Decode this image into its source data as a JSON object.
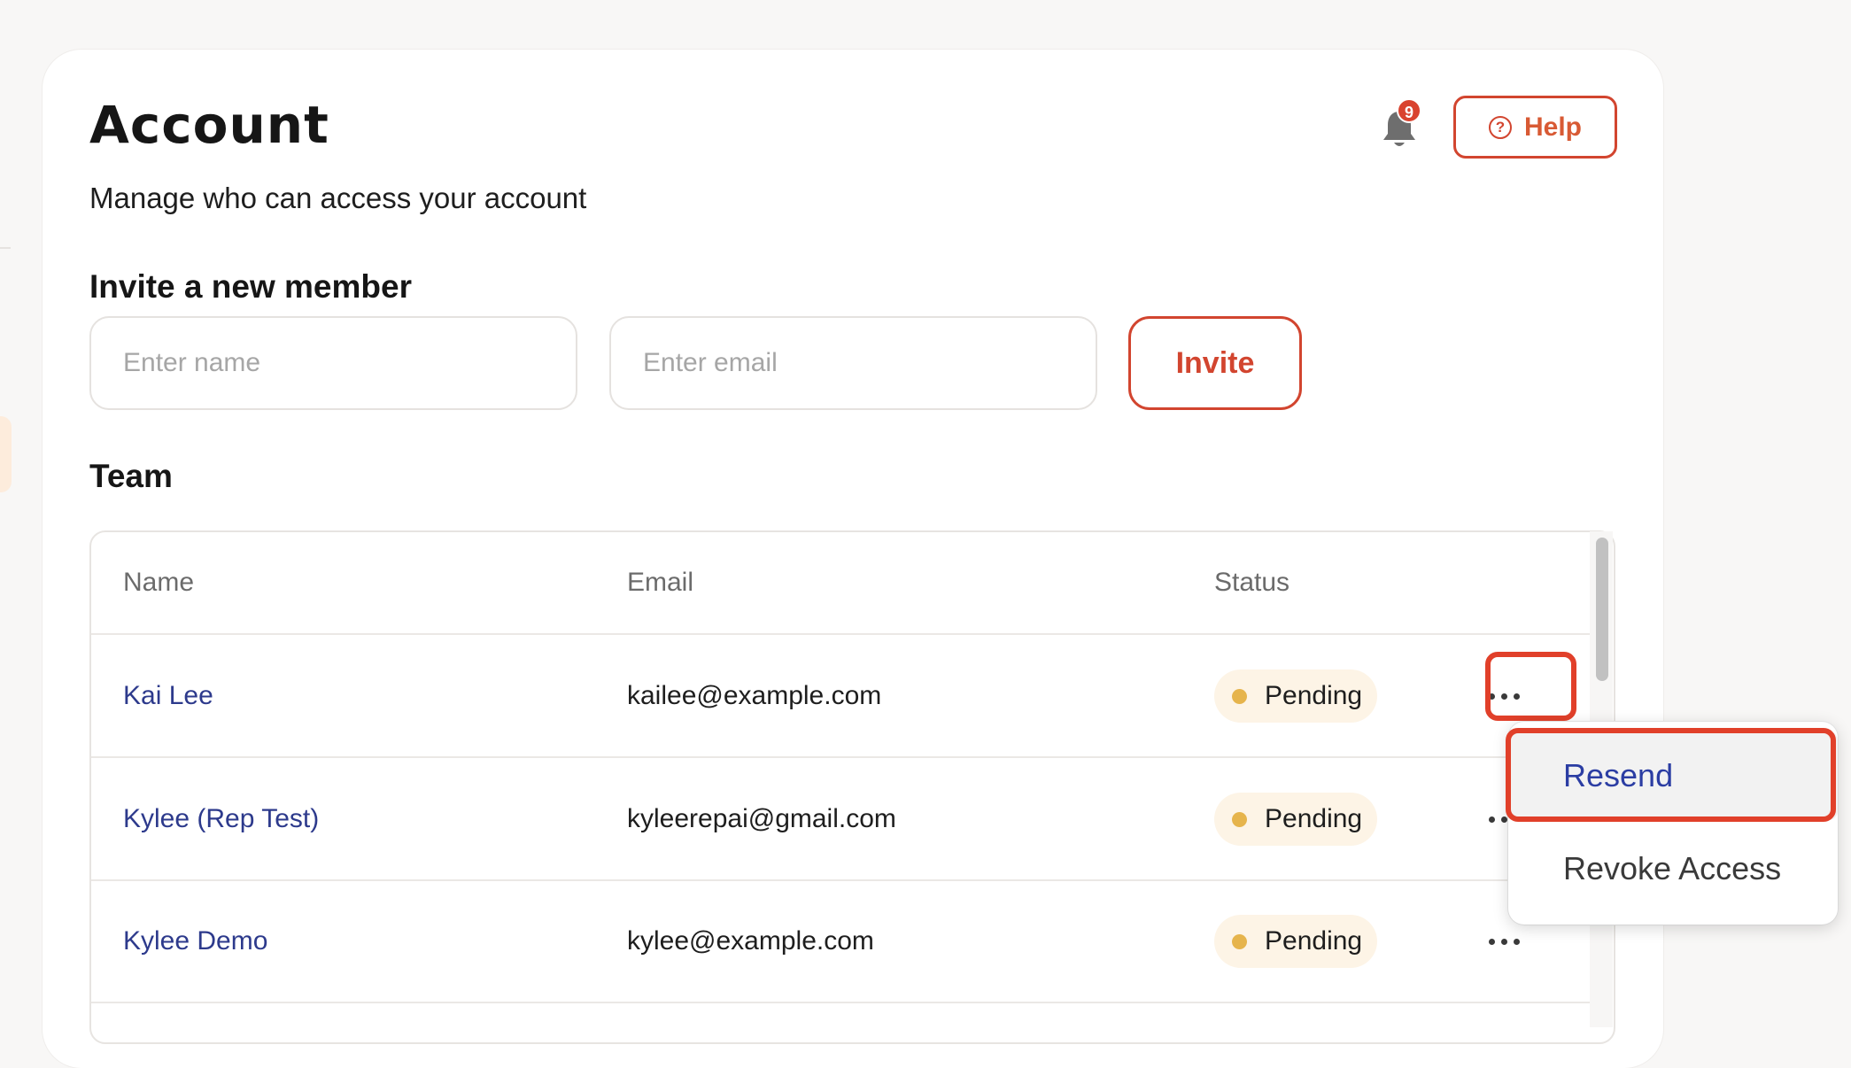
{
  "page": {
    "title": "Account",
    "subtitle": "Manage who can access your account"
  },
  "header": {
    "notification_count": "9",
    "help_label": "Help",
    "help_icon": "?"
  },
  "invite": {
    "section_title": "Invite a new member",
    "name_placeholder": "Enter name",
    "email_placeholder": "Enter email",
    "button_label": "Invite"
  },
  "team": {
    "section_title": "Team",
    "columns": [
      "Name",
      "Email",
      "Status"
    ],
    "rows": [
      {
        "name": "Kai Lee",
        "email": "kailee@example.com",
        "status": "Pending"
      },
      {
        "name": "Kylee (Rep Test)",
        "email": "kyleerepai@gmail.com",
        "status": "Pending"
      },
      {
        "name": "Kylee Demo",
        "email": "kylee@example.com",
        "status": "Pending"
      }
    ]
  },
  "row_menu": {
    "items": [
      "Resend",
      "Revoke Access"
    ]
  },
  "colors": {
    "accent": "#d2452f",
    "highlight": "#e1402a",
    "link": "#2d3a8c",
    "pending_dot": "#e6b44c",
    "pending_bg": "#fdf4e6"
  }
}
